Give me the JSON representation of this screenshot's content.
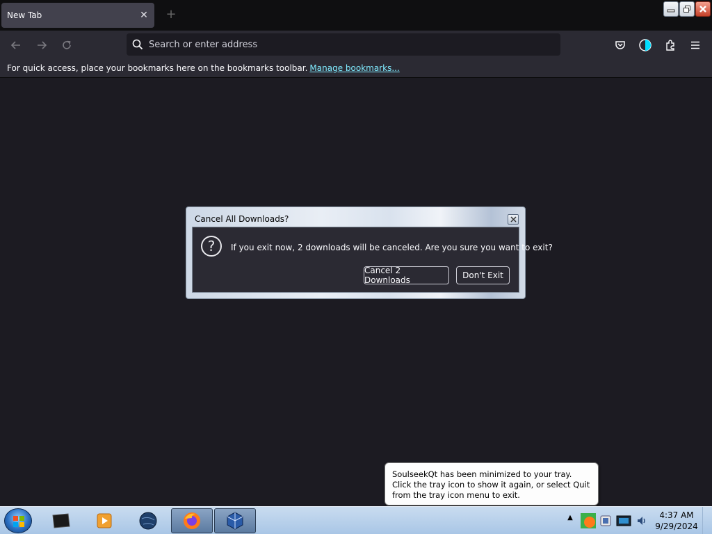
{
  "browser": {
    "tab_title": "New Tab",
    "url_placeholder": "Search or enter address",
    "bookmarks_text": "For quick access, place your bookmarks here on the bookmarks toolbar.",
    "bookmarks_link": "Manage bookmarks..."
  },
  "dialog": {
    "title": "Cancel All Downloads?",
    "message": "If you exit now, 2 downloads will be canceled. Are you sure you want to exit?",
    "cancel_label": "Cancel 2 Downloads",
    "dont_exit_label": "Don't Exit"
  },
  "balloon": {
    "text": "SoulseekQt has been minimized to your tray. Click the tray icon to show it again, or select Quit from the tray icon menu to exit."
  },
  "taskbar": {
    "time": "4:37 AM",
    "date": "9/29/2024"
  },
  "colors": {
    "bg": "#1c1b22",
    "toolbar": "#2b2a33",
    "link": "#80ebff"
  }
}
